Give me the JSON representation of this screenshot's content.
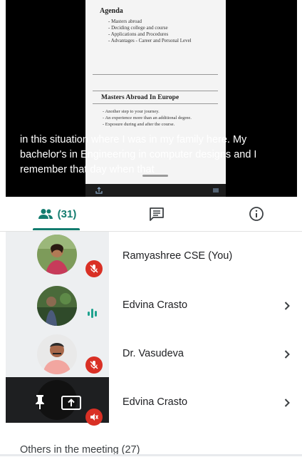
{
  "presentation": {
    "agenda_title": "Agenda",
    "agenda_items": [
      "Masters abroad",
      "Deciding college and course",
      "Applications and Procedures",
      "Advantages - Career and Personal Level"
    ],
    "section_title": "Masters Abroad In Europe",
    "section_items": [
      "Another step to your journey.",
      "An experience more than an additional degree.",
      "Exposure during and after the course."
    ]
  },
  "captions": {
    "line1": "in this situation where I was in my family here. My",
    "line2": "bachelor's in Engineering in computer designs and I",
    "line3": "remember that day when that"
  },
  "tabs": {
    "people_count": "(31)",
    "people_icon": "people-icon",
    "chat_icon": "chat-icon",
    "info_icon": "info-icon",
    "accent_color": "#137c6f"
  },
  "participants": [
    {
      "name": "Ramyashree CSE (You)",
      "status": "muted"
    },
    {
      "name": "Edvina Crasto",
      "status": "speaking"
    },
    {
      "name": "Dr. Vasudeva",
      "status": "muted"
    },
    {
      "name": "Edvina Crasto",
      "status": "presenting"
    }
  ],
  "others": {
    "label": "Others in the meeting (27)"
  },
  "colors": {
    "muted_badge": "#d93025",
    "speaking": "#1ea28e"
  }
}
